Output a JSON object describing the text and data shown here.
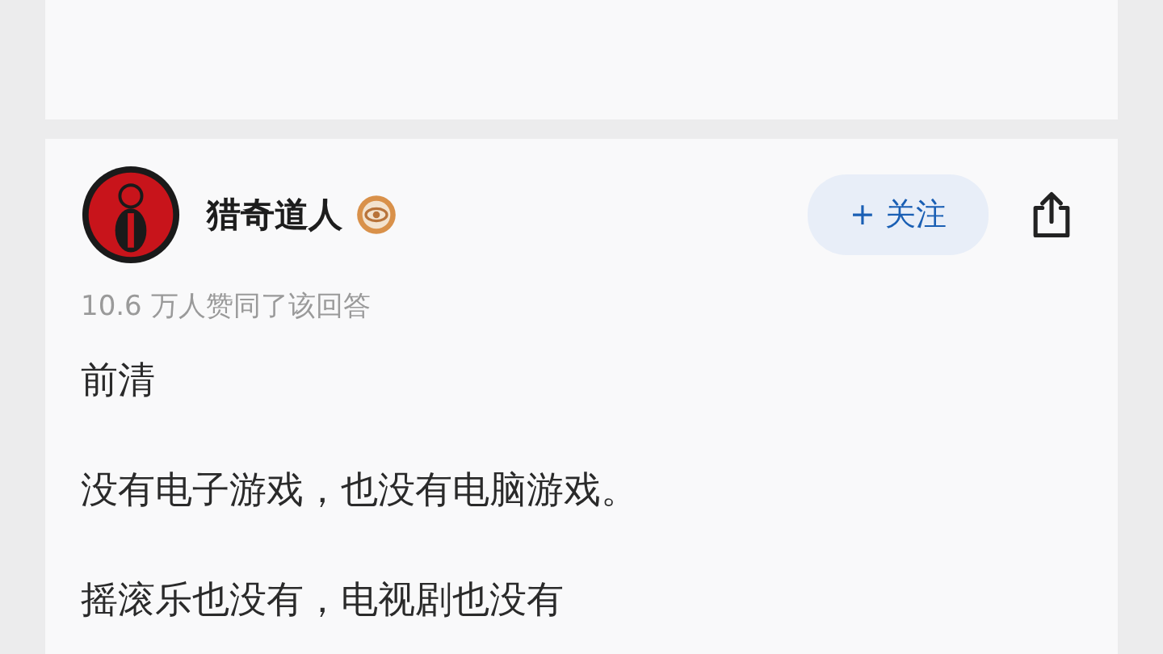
{
  "author": {
    "name": "猎奇道人",
    "follow_button": "+ 关注"
  },
  "meta": "10.6 万人赞同了该回答",
  "paragraphs": [
    "前清",
    "没有电子游戏，也没有电脑游戏。",
    "摇滚乐也没有，电视剧也没有"
  ]
}
